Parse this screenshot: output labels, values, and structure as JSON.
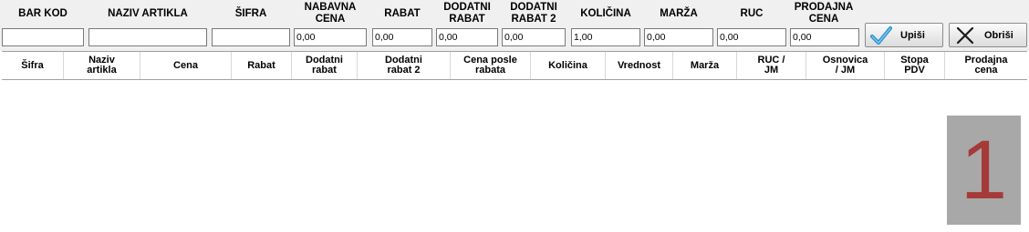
{
  "form": {
    "labels": {
      "bar_kod": "BAR KOD",
      "naziv_artikla": "NAZIV ARTIKLA",
      "sifra": "ŠIFRA",
      "nabavna_cena": "NABAVNA\nCENA",
      "rabat": "RABAT",
      "dodatni_rabat": "DODATNI\nRABAT",
      "dodatni_rabat_2": "DODATNI\nRABAT 2",
      "kolicina": "KOLIČINA",
      "marza": "MARŽA",
      "ruc": "RUC",
      "prodajna_cena": "PRODAJNA\nCENA"
    },
    "values": {
      "bar_kod": "",
      "naziv_artikla": "",
      "sifra": "",
      "nabavna_cena": "0,00",
      "rabat": "0,00",
      "dodatni_rabat": "0,00",
      "dodatni_rabat_2": "0,00",
      "kolicina": "1,00",
      "marza": "0,00",
      "ruc": "0,00",
      "prodajna_cena": "0,00"
    },
    "buttons": {
      "upisi": "Upiši",
      "obrisi": "Obriši"
    }
  },
  "grid": {
    "columns": [
      "Šifra",
      "Naziv\nartikla",
      "Cena",
      "Rabat",
      "Dodatni\nrabat",
      "Dodatni\nrabat 2",
      "Cena posle\nrabata",
      "Količina",
      "Vrednost",
      "Marža",
      "RUC /\nJM",
      "Osnovica\n/ JM",
      "Stopa\nPDV",
      "Prodajna\ncena"
    ],
    "rows": []
  },
  "badge": {
    "number": "1",
    "background": "#a8a8a8",
    "color": "#a53a38"
  },
  "icons": {
    "upisi": "check-icon",
    "obrisi": "x-icon"
  }
}
